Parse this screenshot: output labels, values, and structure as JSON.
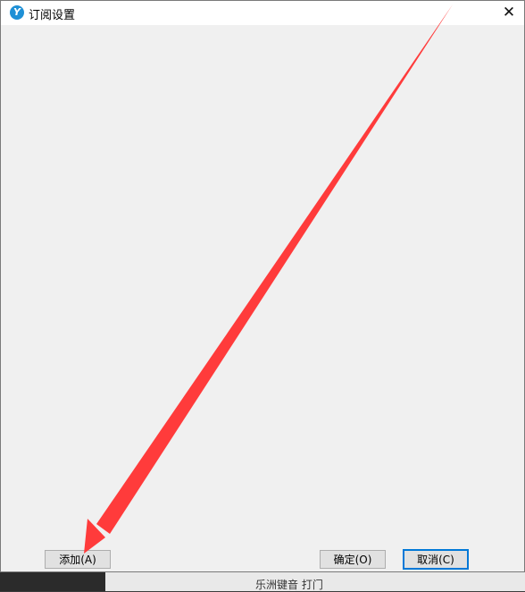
{
  "window": {
    "title": "订阅设置",
    "icon": "app-logo-icon",
    "close_symbol": "✕"
  },
  "buttons": {
    "add_label": "添加(A)",
    "ok_label": "确定(O)",
    "cancel_label": "取消(C)"
  },
  "background_app": {
    "partial_text": "乐洲键音 打门"
  },
  "annotation": {
    "type": "arrow",
    "color": "#ff3b3b",
    "points_to": "add-button"
  },
  "colors": {
    "dialog_bg": "#f0f0f0",
    "titlebar_bg": "#ffffff",
    "focus_border": "#0078d7",
    "arrow": "#ff3b3b"
  }
}
